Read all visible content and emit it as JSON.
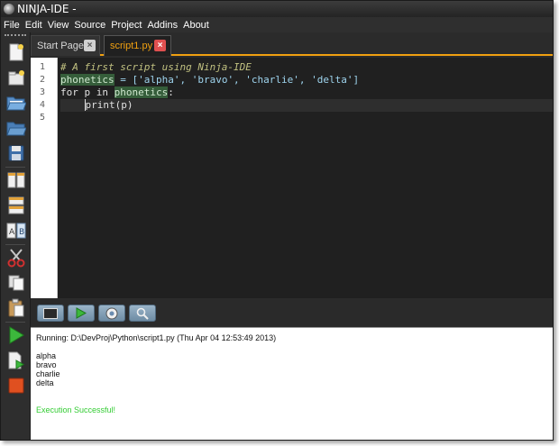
{
  "window": {
    "title": "NINJA-IDE -"
  },
  "menu": [
    "File",
    "Edit",
    "View",
    "Source",
    "Project",
    "Addins",
    "About"
  ],
  "sidebar": {
    "icons": [
      "new-file-icon",
      "new-project-icon",
      "open-file-icon",
      "open-project-icon",
      "save-icon",
      "split-horizontal-icon",
      "split-vertical-icon",
      "find-replace-icon",
      "cut-icon",
      "copy-icon",
      "paste-icon",
      "run-icon",
      "run-file-icon",
      "stop-icon"
    ]
  },
  "tabs": [
    {
      "label": "Start Page",
      "active": false
    },
    {
      "label": "script1.py",
      "active": true
    }
  ],
  "editor": {
    "line_numbers": [
      "1",
      "2",
      "3",
      "4",
      "5"
    ],
    "lines": [
      {
        "text": "# A first script using Ninja-IDE"
      },
      {
        "ident": "phonetics",
        "rest": " = ['alpha', 'bravo', 'charlie', 'delta']"
      },
      {
        "kw": "for p in ",
        "ident": "phonetics",
        "rest": ":"
      },
      {
        "indent": "    ",
        "text": "print(p)"
      },
      {
        "text": ""
      }
    ],
    "current_line": 4
  },
  "runbar": {
    "buttons": [
      "console-icon",
      "play-icon",
      "stop-icon",
      "search-icon"
    ]
  },
  "output": {
    "running": "Running: D:\\DevProj\\Python\\script1.py (Thu Apr 04 12:53:49 2013)",
    "results": [
      "alpha",
      "bravo",
      "charlie",
      "delta"
    ],
    "status": "Execution Successful!"
  },
  "colors": {
    "accent": "#f0a010",
    "success": "#33cc33",
    "highlight": "#355d3a"
  }
}
